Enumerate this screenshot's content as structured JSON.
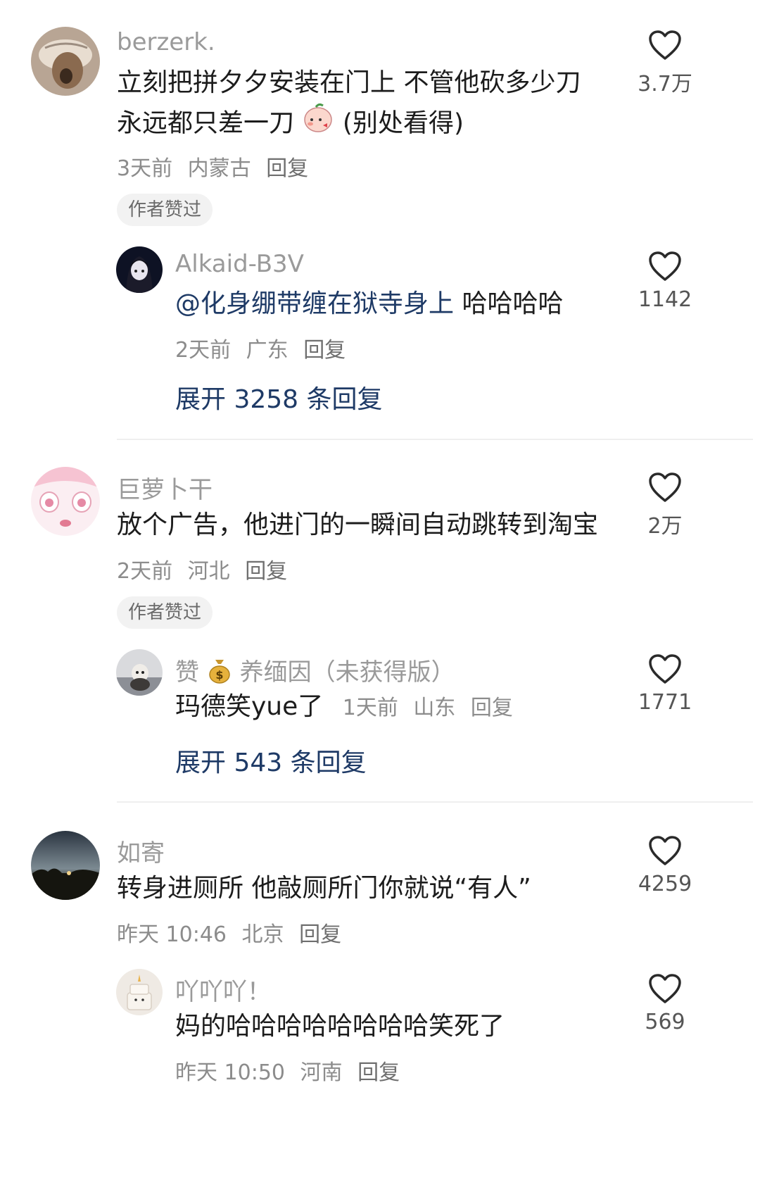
{
  "colors": {
    "link": "#1e3a66",
    "meta": "#8c8c8c",
    "username": "#9a9a9a"
  },
  "comments": [
    {
      "username": "berzerk.",
      "text_line1": "立刻把拼夕夕安装在门上 不管他砍多少刀",
      "text_line2_a": "永远都只差一刀",
      "text_line2_b": "(别处看得)",
      "time": "3天前",
      "location": "内蒙古",
      "reply_label": "回复",
      "likes": "3.7万",
      "badge": "作者赞过",
      "reply": {
        "username": "Alkaid-B3V",
        "mention": "@化身绷带缠在狱寺身上",
        "text": " 哈哈哈哈",
        "time": "2天前",
        "location": "广东",
        "reply_label": "回复",
        "likes": "1142"
      },
      "expand_label": "展开 3258 条回复"
    },
    {
      "username": "巨萝卜干",
      "text": "放个广告，他进门的一瞬间自动跳转到淘宝",
      "time": "2天前",
      "location": "河北",
      "reply_label": "回复",
      "likes": "2万",
      "badge": "作者赞过",
      "reply": {
        "username_prefix": "赞",
        "username": "养缅因（未获得版）",
        "text": "玛德笑yue了",
        "time": "1天前",
        "location": "山东",
        "reply_label": "回复",
        "likes": "1771"
      },
      "expand_label": "展开 543 条回复"
    },
    {
      "username": "如寄",
      "text": "转身进厕所 他敲厕所门你就说“有人”",
      "time": "昨天 10:46",
      "location": "北京",
      "reply_label": "回复",
      "likes": "4259",
      "reply": {
        "username": "吖吖吖！",
        "text": "妈的哈哈哈哈哈哈哈哈笑死了",
        "time": "昨天 10:50",
        "location": "河南",
        "reply_label": "回复",
        "likes": "569"
      }
    }
  ]
}
